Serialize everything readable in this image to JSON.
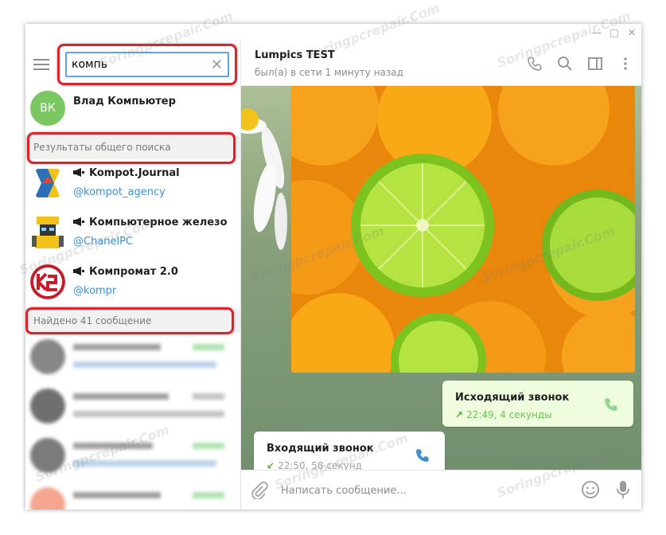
{
  "sidebar": {
    "search": {
      "value": "компь"
    },
    "contact": {
      "name": "Влад Компьютер",
      "initials": "ВК",
      "color": "#7bc862"
    },
    "global_section_label": "Результаты общего поиска",
    "channels": [
      {
        "name": "Kompot.Journal",
        "handle": "@kompot_agency"
      },
      {
        "name": "Компьютерное железо",
        "handle": "@ChanelPC"
      },
      {
        "name": "Компромат 2.0",
        "handle": "@kompr"
      }
    ],
    "messages_section_label": "Найдено 41 сообщение"
  },
  "chat": {
    "title": "Lumpics TEST",
    "status": "был(а) в сети 1 минуту назад",
    "outgoing_call": {
      "title": "Исходящий звонок",
      "detail": "22:49, 4 секунды"
    },
    "incoming_call": {
      "title": "Входящий звонок",
      "detail": "22:50, 58 секунд"
    },
    "composer_placeholder": "Написать сообщение..."
  },
  "colors": {
    "accent": "#3f8fd2",
    "search_border": "#5da4e0",
    "highlight": "#e0212a",
    "call_green": "#4fae33"
  },
  "watermark_text": "Soringpcrepair.Com"
}
